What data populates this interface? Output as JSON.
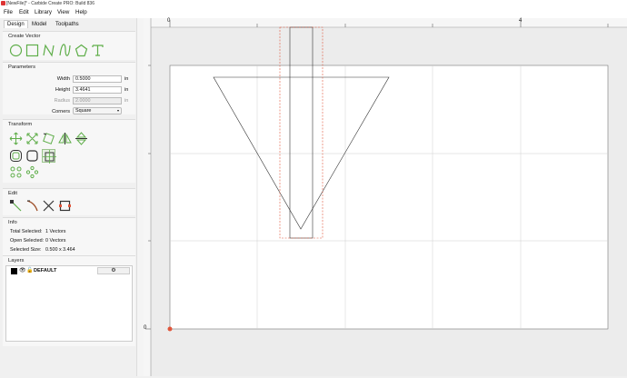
{
  "window": {
    "title": "[NewFile]* - Carbide Create PRO: Build 836"
  },
  "menu": [
    "File",
    "Edit",
    "Library",
    "View",
    "Help"
  ],
  "tabs": [
    "Design",
    "Model",
    "Toolpaths"
  ],
  "panels": {
    "create_vector": {
      "title": "Create Vector",
      "tools": [
        "circle-icon",
        "rectangle-icon",
        "polyline-icon",
        "curve-icon",
        "polygon-icon",
        "text-icon"
      ]
    },
    "parameters": {
      "title": "Parameters",
      "width_label": "Width",
      "width_value": "0.5000",
      "width_unit": "in",
      "height_label": "Height",
      "height_value": "3.4641",
      "height_unit": "in",
      "radius_label": "Radius",
      "radius_value": "2.0000",
      "radius_unit": "in",
      "corners_label": "Corners",
      "corners_value": "Square"
    },
    "transform": {
      "title": "Transform"
    },
    "edit": {
      "title": "Edit"
    },
    "info": {
      "title": "Info",
      "total_selected_label": "Total Selected:",
      "total_selected_value": "1 Vectors",
      "open_selected_label": "Open Selected:",
      "open_selected_value": "0 Vectors",
      "selected_size_label": "Selected Size:",
      "selected_size_value": "0.500 x 3.464"
    },
    "layers": {
      "title": "Layers",
      "items": [
        {
          "name": "DEFAULT",
          "color": "#000000"
        }
      ]
    }
  },
  "rulers": {
    "top_marks": [
      "0",
      "4"
    ],
    "left_marks": [
      "0"
    ]
  },
  "colors": {
    "tool_green": "#5fae4a",
    "selection_red": "#e0553a",
    "grid": "#c8c8c8"
  }
}
